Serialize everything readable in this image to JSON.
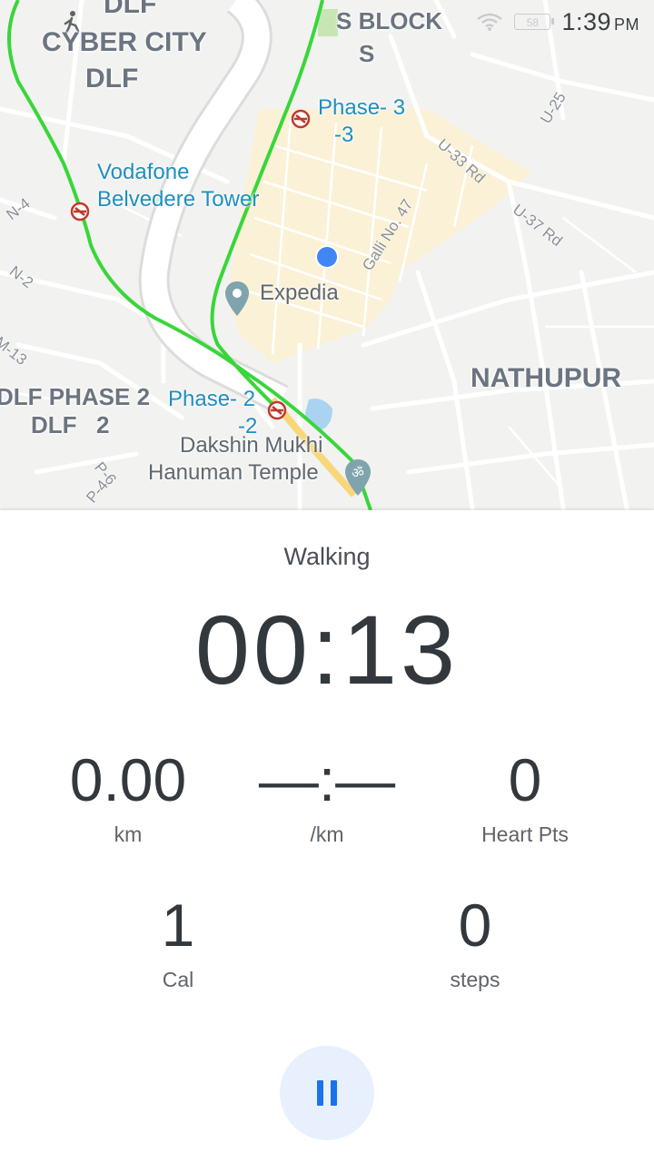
{
  "status_bar": {
    "time": "1:39",
    "ampm": "PM",
    "battery_text": "58",
    "icons": [
      "wifi-icon",
      "battery-icon"
    ]
  },
  "map": {
    "area_labels": {
      "dlf_top": "DLF",
      "cyber_city": "CYBER CITY",
      "dlf_bottom": "DLF",
      "s_block": "S BLOCK",
      "s": "S",
      "nathupur": "NATHUPUR",
      "dlf_phase2": "DLF PHASE 2",
      "dlf2_a": "DLF",
      "dlf2_b": "2"
    },
    "stations": {
      "phase3": "Phase- 3",
      "phase3_sub": "-3",
      "vodafone": "Vodafone",
      "belvedere": "Belvedere Tower",
      "phase2": "Phase- 2",
      "phase2_sub": "-2"
    },
    "pois": {
      "expedia": "Expedia",
      "dakshin": "Dakshin Mukhi",
      "hanuman": "Hanuman Temple"
    },
    "roads": {
      "u25": "U-25",
      "u33": "U-33 Rd",
      "u37": "U-37 Rd",
      "galli47": "Galli No. 47",
      "n4": "N-4",
      "n2": "N-2",
      "m13": "M-13",
      "p4": "P-4",
      "p6": "P-6"
    },
    "colors": {
      "route": "#39d63a",
      "location_dot": "#4285f4",
      "metro": "#c0392b"
    }
  },
  "workout": {
    "activity": "Walking",
    "timer": "00:13",
    "distance_value": "0.00",
    "distance_unit": "km",
    "pace_value": "—:—",
    "pace_unit": "/km",
    "heart_value": "0",
    "heart_unit": "Heart Pts",
    "cal_value": "1",
    "cal_unit": "Cal",
    "steps_value": "0",
    "steps_unit": "steps"
  },
  "controls": {
    "pause_icon": "pause-icon",
    "accent": "#1a73e8"
  }
}
